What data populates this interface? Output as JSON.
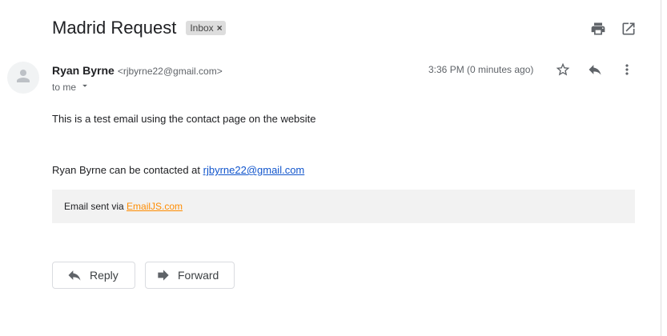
{
  "email": {
    "subject": "Madrid Request",
    "label": "Inbox",
    "label_remove": "×",
    "sender_name": "Ryan Byrne",
    "sender_email": "<rjbyrne22@gmail.com>",
    "recipient": "to me",
    "time": "3:36 PM (0 minutes ago)",
    "body_line1": "This is a test email using the contact page on the website",
    "contact_prefix": "Ryan Byrne can be contacted at ",
    "contact_email": "rjbyrne22@gmail.com",
    "footer_prefix": "Email sent via ",
    "footer_link": "EmailJS.com"
  },
  "actions": {
    "reply_label": "Reply",
    "forward_label": "Forward"
  },
  "icons": {
    "print": "print-icon",
    "open_new_window": "open-in-new-window-icon",
    "star": "star-icon",
    "reply": "reply-icon",
    "more": "more-vert-icon",
    "avatar": "avatar-person-icon",
    "dropdown": "chevron-down-icon",
    "forward": "forward-icon"
  },
  "colors": {
    "link": "#1155cc",
    "footer_link": "#ff8c00",
    "label_chip": "#dddddd"
  }
}
